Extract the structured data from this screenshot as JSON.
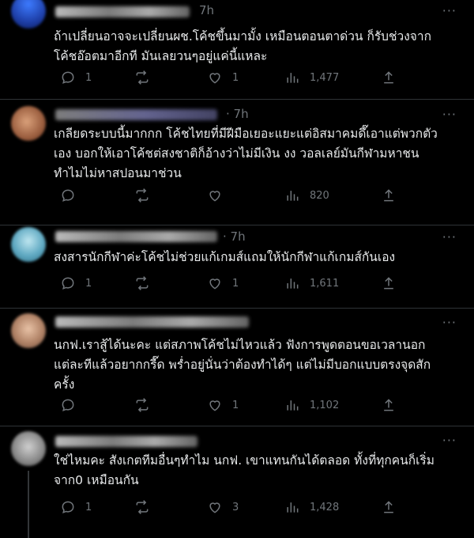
{
  "replies": [
    {
      "time": "7h",
      "more": "···",
      "text": "ถ้าเปลี่ยนอาจจะเปลี่ยนผช.โค้ชขึ้นมามั้ง เหมือนตอนตาด่วน ก็รับช่วงจาก\nโค้ชอ๊อตมาอีกที มันเลยวนๆอยู่แค่นี้แหละ",
      "replies": "1",
      "retweets": "",
      "likes": "1",
      "views": "1,477",
      "avatar_color": "#1e5bd6"
    },
    {
      "time": "· 7h",
      "more": "···",
      "text": "เกลียดระบบนี้มากกก โค้ชไทยที่มีฝีมือเยอะแยะแต่อิสมาคมดึ๊เอาแต่พวกตัว\nเอง บอกให้เอาโค้ชต่สงชาติก็อ้างว่าไม่มีเงิน งง วอลเลย์มันกีฬามหาชน\nทำไมไม่หาสปอนมาช่วน",
      "replies": "",
      "retweets": "",
      "likes": "",
      "views": "820",
      "avatar_color": "#b07a5a"
    },
    {
      "time": "· 7h",
      "more": "···",
      "text": "สงสารนักกีฬาค่ะโค้ชไม่ช่วยแก้เกมส์แถมให้นักกีฬาแก้เกมส์กันเอง",
      "replies": "1",
      "retweets": "",
      "likes": "1",
      "views": "1,611",
      "avatar_color": "#7fc3d6"
    },
    {
      "time": "",
      "more": "···",
      "text": "นกฟ.เราสู้ได้นะคะ แต่สภาพโค้ชไม่ไหวแล้ว ฟังการพูดตอนขอเวลานอก\nแต่ละทีแล้วอยากกรี๊ด พร่ำอยู่นั่นว่าต้องทำได้ๆ แต่ไม่มีบอกแบบตรงจุดสัก\nครั้ง",
      "replies": "",
      "retweets": "",
      "likes": "1",
      "views": "1,102",
      "avatar_color": "#c7a389"
    },
    {
      "time": "",
      "more": "···",
      "text": "ใช่ไหมคะ สังเกตทีมอื่นๆทำไม นกฟ. เขาแทนกันได้ตลอด ทั้งที่ทุกคนก็เริ่ม\nจาก0 เหมือนกัน",
      "replies": "1",
      "retweets": "",
      "likes": "3",
      "views": "1,428",
      "avatar_color": "#8c8c8c"
    }
  ]
}
